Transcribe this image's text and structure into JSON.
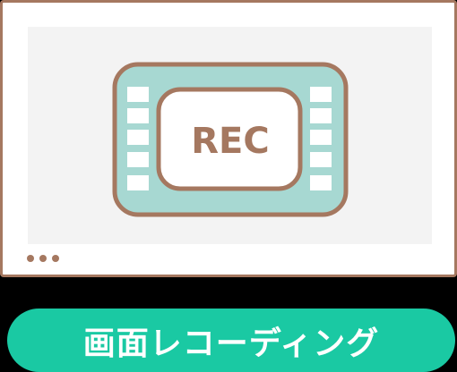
{
  "illustration": {
    "icon": "film-rec-icon",
    "rec_text": "REC"
  },
  "window_controls": {
    "icon": "more-dots-icon"
  },
  "label": {
    "text": "画面レコーディング"
  },
  "colors": {
    "outline": "#a57860",
    "film_fill": "#a7d8d2",
    "screen_bg": "#f3f3f3",
    "pill_bg": "#1ac9a3",
    "label_text": "#ffffff"
  }
}
